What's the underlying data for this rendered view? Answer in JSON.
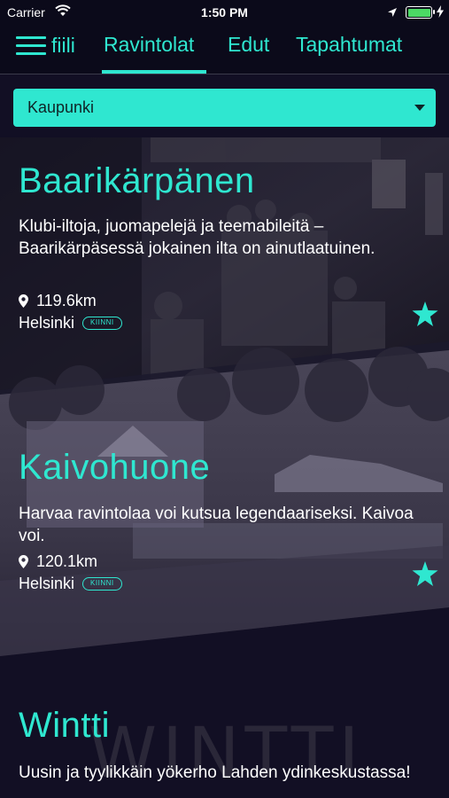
{
  "status_bar": {
    "carrier": "Carrier",
    "time": "1:50 PM",
    "battery_level": 1.0
  },
  "nav": {
    "logo": "fiili",
    "tabs": [
      {
        "label": "Ravintolat",
        "active": true
      },
      {
        "label": "Edut",
        "active": false
      },
      {
        "label": "Tapahtumat",
        "active": false
      }
    ]
  },
  "filter": {
    "selected": "Kaupunki"
  },
  "venues": [
    {
      "name": "Baarikärpänen",
      "description": "Klubi-iltoja, juomapelejä ja teemabileitä – Baarikärpäsessä jokainen ilta on ainutlaatuinen.",
      "distance": "119.6km",
      "city": "Helsinki",
      "status": "KIINNI"
    },
    {
      "name": "Kaivohuone",
      "description": "Harvaa ravintolaa voi kutsua legendaariseksi. Kaivoa voi.",
      "distance": "120.1km",
      "city": "Helsinki",
      "status": "KIINNI"
    },
    {
      "name": "Wintti",
      "description": "Uusin ja tyylikkäin yökerho Lahden ydinkeskustassa!",
      "backdrop_text": "WINTTI"
    }
  ],
  "colors": {
    "accent": "#2fe7d0",
    "background": "#120f24",
    "text": "#ffffff"
  },
  "icons": {
    "menu": "hamburger-icon",
    "dropdown": "chevron-down-icon",
    "location": "location-pin-icon",
    "favorite": "star-icon"
  }
}
